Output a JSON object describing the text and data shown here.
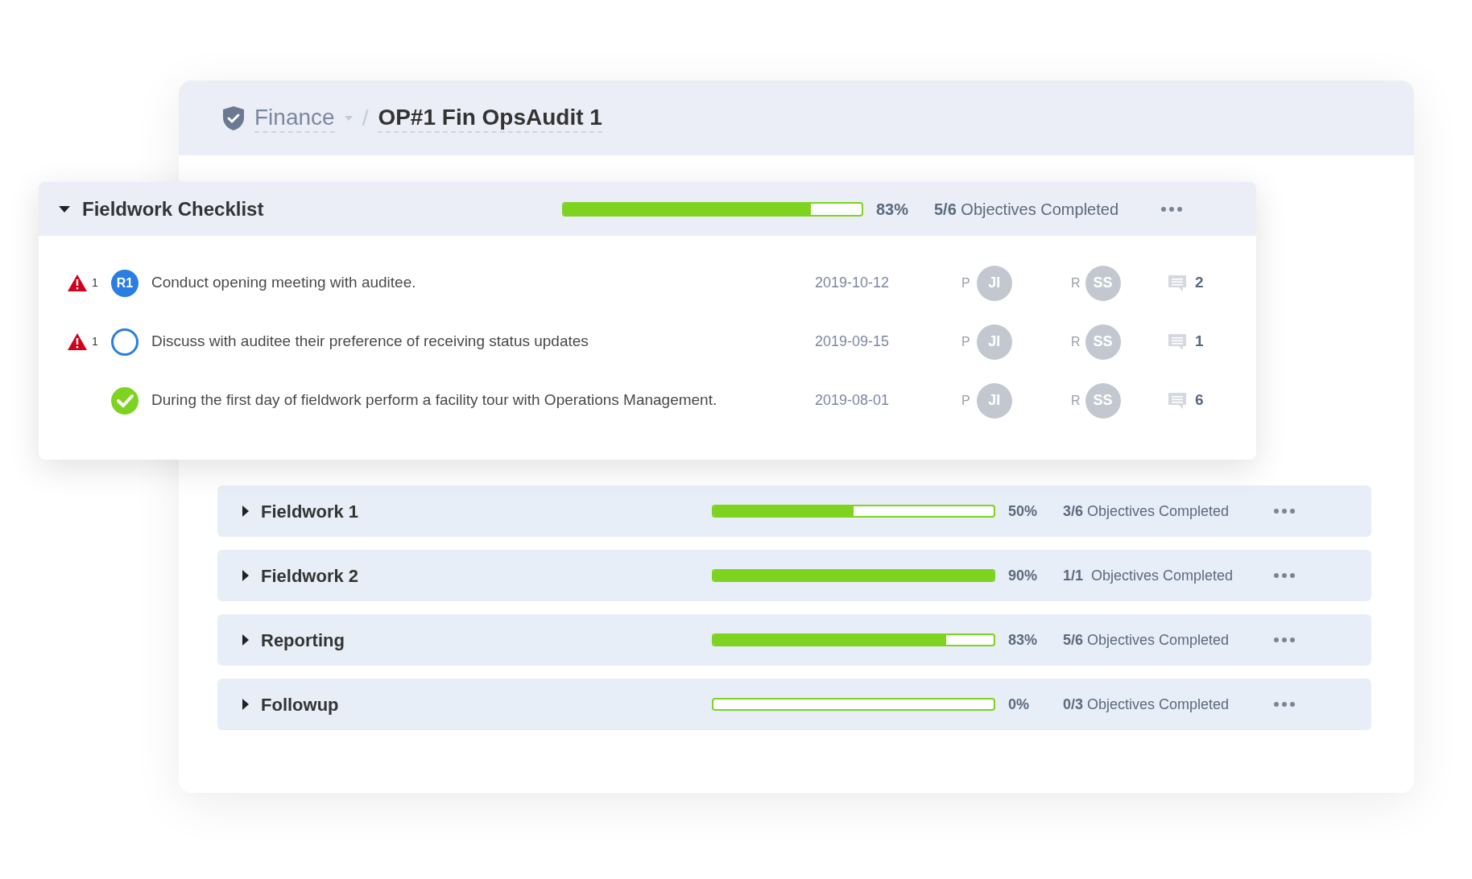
{
  "breadcrumb": {
    "parent": "Finance",
    "separator": "/",
    "title": "OP#1 Fin OpsAudit 1"
  },
  "checklist": {
    "title": "Fieldwork Checklist",
    "expanded": true,
    "level": 0.83,
    "percent": "83%",
    "objectives": "**5/6** Objectives Completed",
    "items": [
      {
        "warning_count": "1",
        "kind": "reference",
        "badge": "R1",
        "text": "Conduct opening meeting with auditee.",
        "date": "2019-10-12",
        "preparer_label": "P",
        "preparer": "JI",
        "reviewer_label": "R",
        "reviewer": "SS",
        "comments": "2"
      },
      {
        "warning_count": "1",
        "kind": "open",
        "text": "Discuss with auditee their preference of receiving status updates",
        "date": "2019-09-15",
        "preparer_label": "P",
        "preparer": "JI",
        "reviewer_label": "R",
        "reviewer": "SS",
        "comments": "1"
      },
      {
        "kind": "done",
        "text": "During the first day of fieldwork perform a facility tour with Operations Management.",
        "date": "2019-08-01",
        "preparer_label": "P",
        "preparer": "JI",
        "reviewer_label": "R",
        "reviewer": "SS",
        "comments": "6"
      }
    ]
  },
  "sections": [
    {
      "name": "Fieldwork 1",
      "expanded": false,
      "level": 0.5,
      "percent": "50%",
      "objectives": "**3/6** Objectives Completed"
    },
    {
      "name": "Fieldwork 2",
      "expanded": false,
      "level": 1,
      "percent": "90%",
      "objectives": "**1/1**  Objectives Completed"
    },
    {
      "name": "Reporting",
      "expanded": false,
      "level": 0.83,
      "percent": "83%",
      "objectives": "**5/6** Objectives Completed"
    },
    {
      "name": "Followup",
      "expanded": false,
      "level": 0,
      "percent": "0%",
      "objectives": "**0/3** Objectives Completed"
    }
  ]
}
